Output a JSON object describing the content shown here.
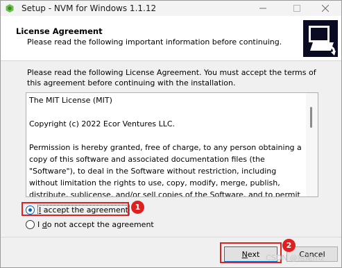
{
  "window": {
    "title": "Setup - NVM for Windows 1.1.12",
    "app_icon": "nvm-setup-icon"
  },
  "header": {
    "title": "License Agreement",
    "subtitle": "Please read the following important information before continuing."
  },
  "intro": "Please read the following License Agreement. You must accept the terms of this agreement before continuing with the installation.",
  "license": {
    "text": "The MIT License (MIT)\n\nCopyright (c) 2022 Ecor Ventures LLC.\n\nPermission is hereby granted, free of charge, to any person obtaining a copy of this software and associated documentation files (the \"Software\"), to deal in the Software without restriction, including without limitation the rights to use, copy, modify, merge, publish, distribute, sublicense, and/or sell copies of the Software, and to permit persons to whom the Software is"
  },
  "options": {
    "accept": "I accept the agreement",
    "decline": "I do not accept the agreement",
    "selected": "accept"
  },
  "buttons": {
    "next": "Next",
    "cancel": "Cancel"
  },
  "annotations": {
    "badge1": "1",
    "badge2": "2",
    "color": "#e02020"
  },
  "watermark": "CSDN @抬尾mz"
}
